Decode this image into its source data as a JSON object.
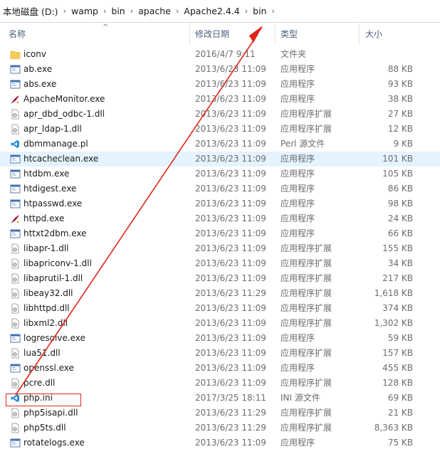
{
  "breadcrumb": [
    "本地磁盘 (D:)",
    "wamp",
    "bin",
    "apache",
    "Apache2.4.4",
    "bin"
  ],
  "breadcrumb_sep": "›",
  "columns": {
    "name": "名称",
    "date": "修改日期",
    "type": "类型",
    "size": "大小"
  },
  "sort_glyph": "^",
  "files": [
    {
      "name": "iconv",
      "date": "2016/4/7 9:11",
      "type": "文件夹",
      "size": "",
      "icon": "folder-icon"
    },
    {
      "name": "ab.exe",
      "date": "2013/6/23 11:09",
      "type": "应用程序",
      "size": "88 KB",
      "icon": "exe-icon"
    },
    {
      "name": "abs.exe",
      "date": "2013/6/23 11:09",
      "type": "应用程序",
      "size": "93 KB",
      "icon": "exe-icon"
    },
    {
      "name": "ApacheMonitor.exe",
      "date": "2013/6/23 11:09",
      "type": "应用程序",
      "size": "38 KB",
      "icon": "feather-icon"
    },
    {
      "name": "apr_dbd_odbc-1.dll",
      "date": "2013/6/23 11:09",
      "type": "应用程序扩展",
      "size": "27 KB",
      "icon": "dll-icon"
    },
    {
      "name": "apr_ldap-1.dll",
      "date": "2013/6/23 11:09",
      "type": "应用程序扩展",
      "size": "12 KB",
      "icon": "dll-icon"
    },
    {
      "name": "dbmmanage.pl",
      "date": "2013/6/23 11:09",
      "type": "Perl 源文件",
      "size": "9 KB",
      "icon": "vscode-icon"
    },
    {
      "name": "htcacheclean.exe",
      "date": "2013/6/23 11:09",
      "type": "应用程序",
      "size": "101 KB",
      "icon": "exe-icon"
    },
    {
      "name": "htdbm.exe",
      "date": "2013/6/23 11:09",
      "type": "应用程序",
      "size": "105 KB",
      "icon": "exe-icon"
    },
    {
      "name": "htdigest.exe",
      "date": "2013/6/23 11:09",
      "type": "应用程序",
      "size": "86 KB",
      "icon": "exe-icon"
    },
    {
      "name": "htpasswd.exe",
      "date": "2013/6/23 11:09",
      "type": "应用程序",
      "size": "98 KB",
      "icon": "exe-icon"
    },
    {
      "name": "httpd.exe",
      "date": "2013/6/23 11:09",
      "type": "应用程序",
      "size": "24 KB",
      "icon": "feather-icon"
    },
    {
      "name": "httxt2dbm.exe",
      "date": "2013/6/23 11:09",
      "type": "应用程序",
      "size": "66 KB",
      "icon": "exe-icon"
    },
    {
      "name": "libapr-1.dll",
      "date": "2013/6/23 11:09",
      "type": "应用程序扩展",
      "size": "155 KB",
      "icon": "dll-icon"
    },
    {
      "name": "libapriconv-1.dll",
      "date": "2013/6/23 11:09",
      "type": "应用程序扩展",
      "size": "34 KB",
      "icon": "dll-icon"
    },
    {
      "name": "libaprutil-1.dll",
      "date": "2013/6/23 11:09",
      "type": "应用程序扩展",
      "size": "217 KB",
      "icon": "dll-icon"
    },
    {
      "name": "libeay32.dll",
      "date": "2013/6/23 11:29",
      "type": "应用程序扩展",
      "size": "1,618 KB",
      "icon": "dll-icon"
    },
    {
      "name": "libhttpd.dll",
      "date": "2013/6/23 11:09",
      "type": "应用程序扩展",
      "size": "374 KB",
      "icon": "dll-icon"
    },
    {
      "name": "libxml2.dll",
      "date": "2013/6/23 11:09",
      "type": "应用程序扩展",
      "size": "1,302 KB",
      "icon": "dll-icon"
    },
    {
      "name": "logresolve.exe",
      "date": "2013/6/23 11:09",
      "type": "应用程序",
      "size": "59 KB",
      "icon": "exe-icon"
    },
    {
      "name": "lua51.dll",
      "date": "2013/6/23 11:09",
      "type": "应用程序扩展",
      "size": "157 KB",
      "icon": "dll-icon"
    },
    {
      "name": "openssl.exe",
      "date": "2013/6/23 11:09",
      "type": "应用程序",
      "size": "455 KB",
      "icon": "exe-icon"
    },
    {
      "name": "pcre.dll",
      "date": "2013/6/23 11:09",
      "type": "应用程序扩展",
      "size": "128 KB",
      "icon": "dll-icon"
    },
    {
      "name": "php.ini",
      "date": "2017/3/25 18:11",
      "type": "INI 源文件",
      "size": "69 KB",
      "icon": "vscode-icon"
    },
    {
      "name": "php5isapi.dll",
      "date": "2013/6/23 11:29",
      "type": "应用程序扩展",
      "size": "21 KB",
      "icon": "dll-icon"
    },
    {
      "name": "php5ts.dll",
      "date": "2013/6/23 11:29",
      "type": "应用程序扩展",
      "size": "8,363 KB",
      "icon": "dll-icon"
    },
    {
      "name": "rotatelogs.exe",
      "date": "2013/6/23 11:09",
      "type": "应用程序",
      "size": "75 KB",
      "icon": "exe-icon"
    }
  ],
  "highlighted_row": "htcacheclean.exe",
  "colors": {
    "annotation": "#e0261b",
    "highlight": "#e5f3ff",
    "header_text": "#4d6082"
  }
}
